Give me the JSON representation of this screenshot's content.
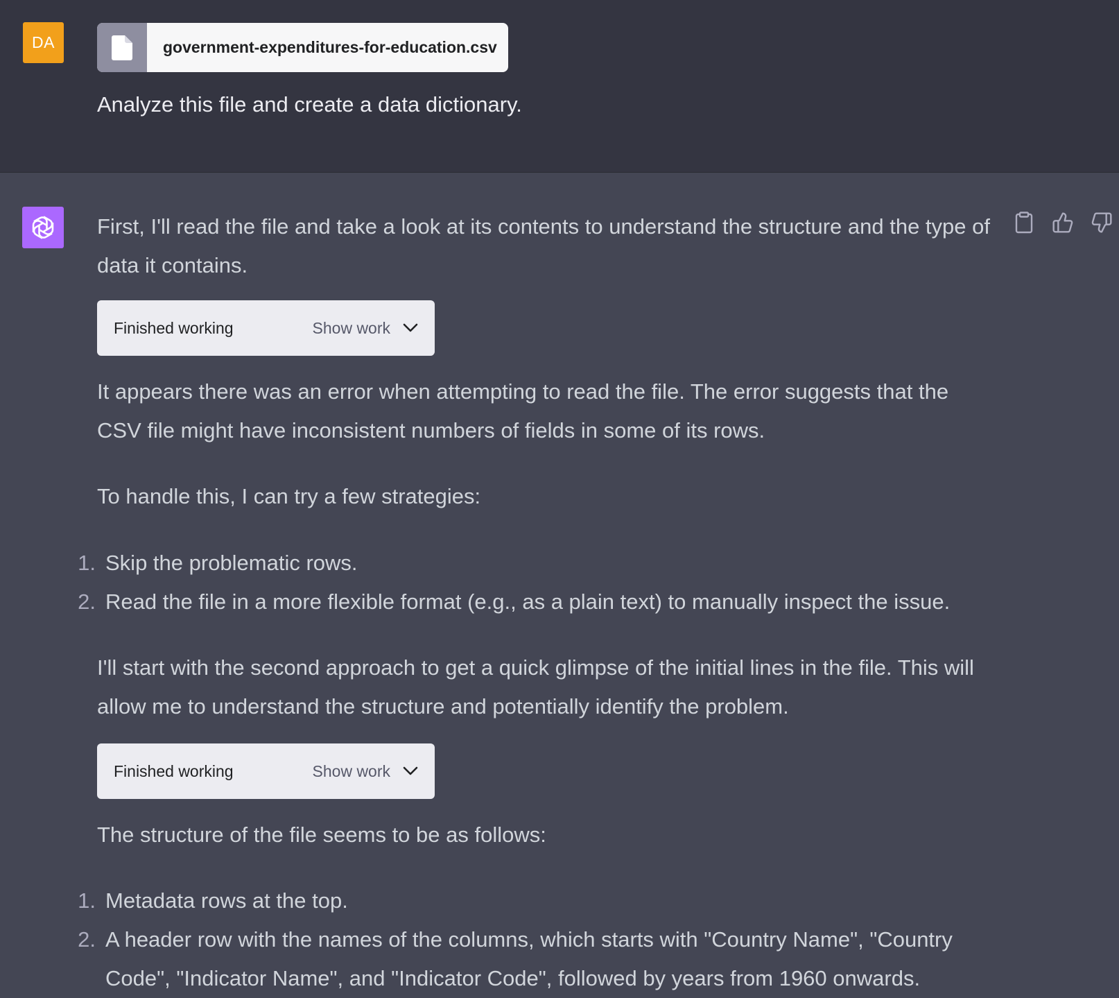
{
  "user": {
    "avatar_initials": "DA",
    "file_name": "government-expenditures-for-education.csv",
    "message": "Analyze this file and create a data dictionary."
  },
  "assistant": {
    "intro": "First, I'll read the file and take a look at its contents to understand the structure and the type of data it contains.",
    "work_boxes": [
      {
        "status": "Finished working",
        "toggle_label": "Show work"
      },
      {
        "status": "Finished working",
        "toggle_label": "Show work"
      }
    ],
    "error_text": "It appears there was an error when attempting to read the file. The error suggests that the CSV file might have inconsistent numbers of fields in some of its rows.",
    "strategies_intro": "To handle this, I can try a few strategies:",
    "strategies": [
      {
        "num": "1.",
        "text": "Skip the problematic rows."
      },
      {
        "num": "2.",
        "text": "Read the file in a more flexible format (e.g., as a plain text) to manually inspect the issue."
      }
    ],
    "approach_text": "I'll start with the second approach to get a quick glimpse of the initial lines in the file. This will allow me to understand the structure and potentially identify the problem.",
    "structure_intro": "The structure of the file seems to be as follows:",
    "structure_items": [
      {
        "num": "1.",
        "text": "Metadata rows at the top."
      },
      {
        "num": "2.",
        "text": "A header row with the names of the columns, which starts with \"Country Name\", \"Country Code\", \"Indicator Name\", and \"Indicator Code\", followed by years from 1960 onwards."
      }
    ]
  },
  "colors": {
    "user_bg": "#343541",
    "assistant_bg": "#444654",
    "user_avatar": "#f2a01b",
    "assistant_avatar": "#ab68ff"
  },
  "icons": {
    "file": "file-icon",
    "assistant_logo": "openai-logo-icon",
    "copy": "clipboard-icon",
    "like": "thumbs-up-icon",
    "dislike": "thumbs-down-icon",
    "expand": "chevron-down-icon"
  }
}
